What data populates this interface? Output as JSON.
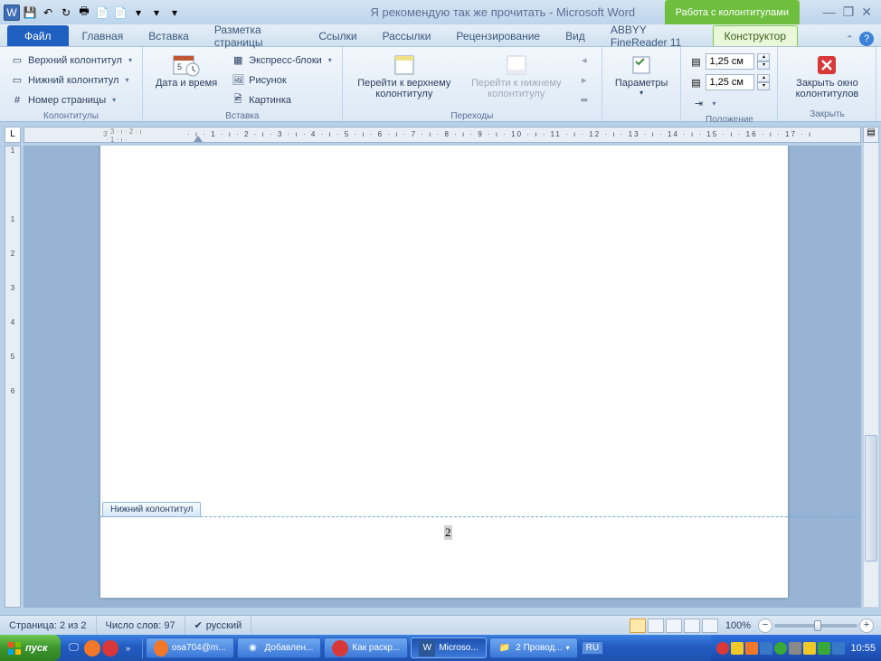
{
  "title": {
    "doc": "Я рекомендую так же прочитать",
    "app": "Microsoft Word"
  },
  "contextual_label": "Работа с колонтитулами",
  "tabs": {
    "file": "Файл",
    "home": "Главная",
    "insert": "Вставка",
    "layout": "Разметка страницы",
    "references": "Ссылки",
    "mailings": "Рассылки",
    "review": "Рецензирование",
    "view": "Вид",
    "abbyy": "ABBYY FineReader 11",
    "design": "Конструктор"
  },
  "ribbon": {
    "headers_group": "Колонтитулы",
    "header": "Верхний колонтитул",
    "footer": "Нижний колонтитул",
    "page_number": "Номер страницы",
    "insert_group": "Вставка",
    "date_time": "Дата и время",
    "quick_parts": "Экспресс-блоки",
    "picture": "Рисунок",
    "clip_art": "Картинка",
    "navigation_group": "Переходы",
    "goto_header": "Перейти к верхнему колонтитулу",
    "goto_footer": "Перейти к нижнему колонтитулу",
    "options_group": "",
    "options": "Параметры",
    "position_group": "Положение",
    "top_value": "1,25 см",
    "bottom_value": "1,25 см",
    "close_group": "Закрыть",
    "close": "Закрыть окно колонтитулов"
  },
  "document": {
    "footer_tab": "Нижний колонтитул",
    "page_num": "2"
  },
  "status": {
    "page": "Страница: 2 из 2",
    "words": "Число слов: 97",
    "lang": "русский",
    "zoom": "100%"
  },
  "taskbar": {
    "start": "пуск",
    "items": [
      "osa704@m...",
      "Добавлен...",
      "Как раскр...",
      "Microso...",
      "2 Провод..."
    ],
    "lang": "RU",
    "clock": "10:55"
  }
}
